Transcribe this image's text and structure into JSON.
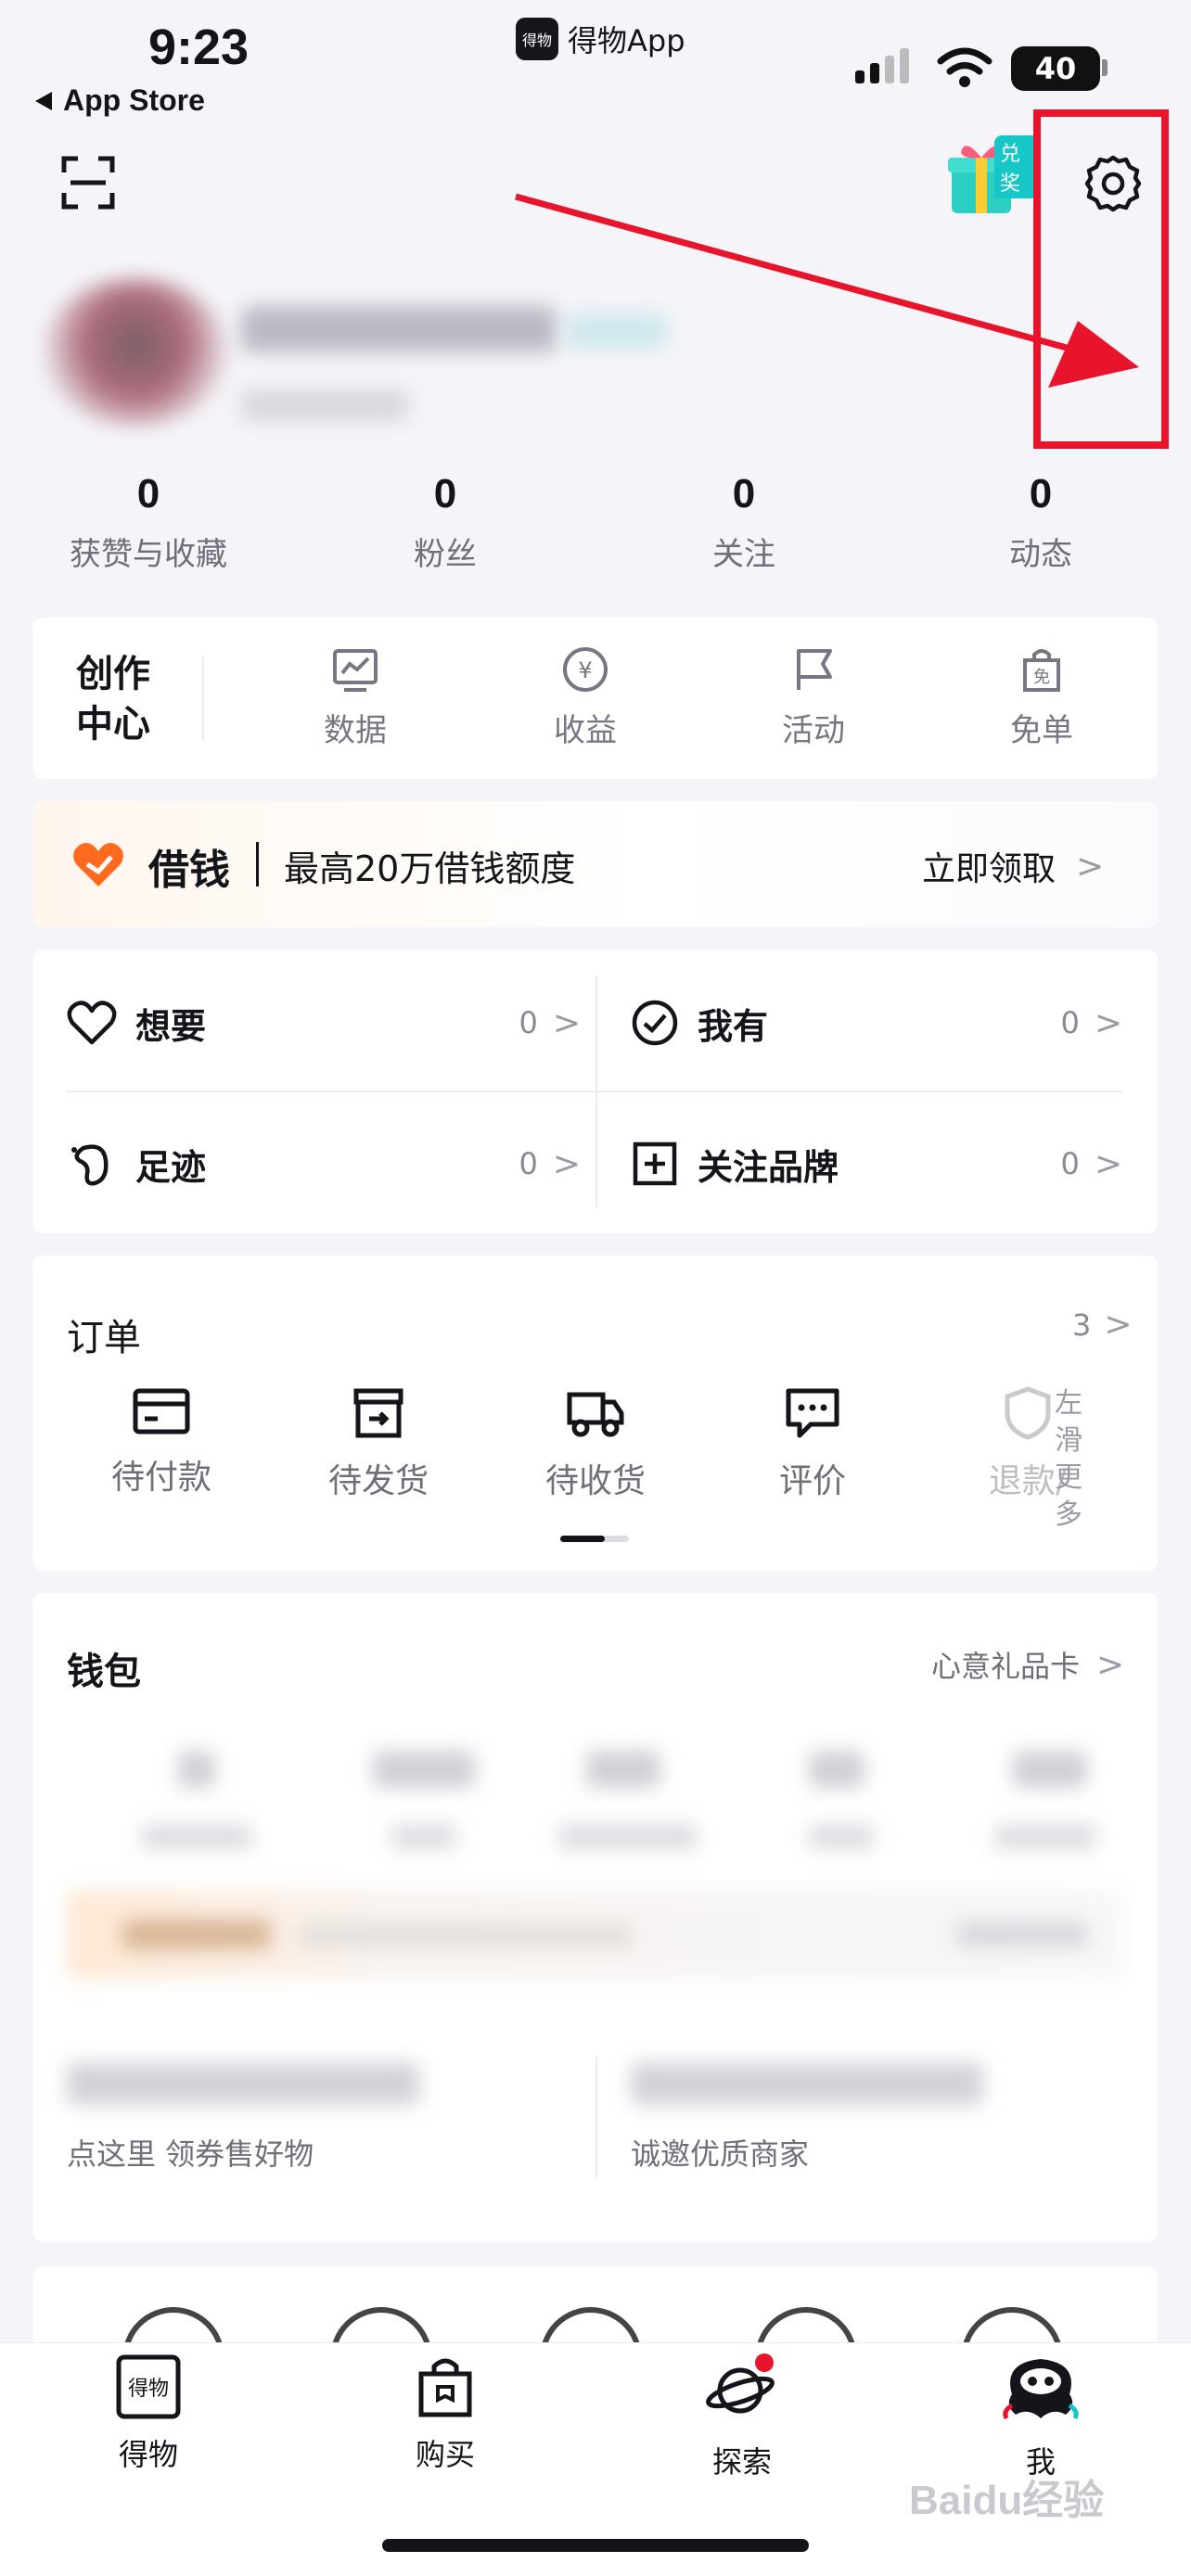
{
  "status_bar": {
    "time": "9:23",
    "app_name": "得物App",
    "app_logo_text": "得物",
    "back_label": "App Store",
    "battery": "40"
  },
  "header": {
    "gift_badge": "兑奖"
  },
  "stats": [
    {
      "value": "0",
      "label": "获赞与收藏"
    },
    {
      "value": "0",
      "label": "粉丝"
    },
    {
      "value": "0",
      "label": "关注"
    },
    {
      "value": "0",
      "label": "动态"
    }
  ],
  "creator": {
    "title_line1": "创作",
    "title_line2": "中心",
    "tools": [
      {
        "label": "数据",
        "icon": "chart-icon"
      },
      {
        "label": "收益",
        "icon": "yuan-coin-icon"
      },
      {
        "label": "活动",
        "icon": "flag-icon"
      },
      {
        "label": "免单",
        "icon": "free-bag-icon"
      }
    ],
    "free_glyph": "免",
    "yuan_glyph": "¥"
  },
  "loan": {
    "brand": "借钱",
    "text": "最高20万借钱额度",
    "action": "立即领取"
  },
  "collections": [
    {
      "label": "想要",
      "count": "0"
    },
    {
      "label": "我有",
      "count": "0"
    },
    {
      "label": "足迹",
      "count": "0"
    },
    {
      "label": "关注品牌",
      "count": "0"
    }
  ],
  "orders": {
    "title": "订单",
    "count": "3",
    "items": [
      {
        "label": "待付款"
      },
      {
        "label": "待发货"
      },
      {
        "label": "待收货"
      },
      {
        "label": "评价"
      },
      {
        "label": "退款/"
      }
    ],
    "swipe_hint": [
      "左",
      "滑",
      "更",
      "多"
    ]
  },
  "wallet": {
    "title": "钱包",
    "gift_card": "心意礼品卡"
  },
  "promos": [
    {
      "text": "点这里 领券售好物"
    },
    {
      "text": "诚邀优质商家"
    }
  ],
  "tabbar": {
    "items": [
      {
        "label": "得物"
      },
      {
        "label": "购买"
      },
      {
        "label": "探索"
      },
      {
        "label": "我"
      }
    ],
    "logo_text": "得物"
  },
  "watermark": "Baidu经验",
  "colors": {
    "accent_red": "#e8142b",
    "loan_orange": "#ff6a1e",
    "teal": "#17c6c6",
    "text_dark": "#14151a",
    "text_gray": "#6f6f7a"
  }
}
